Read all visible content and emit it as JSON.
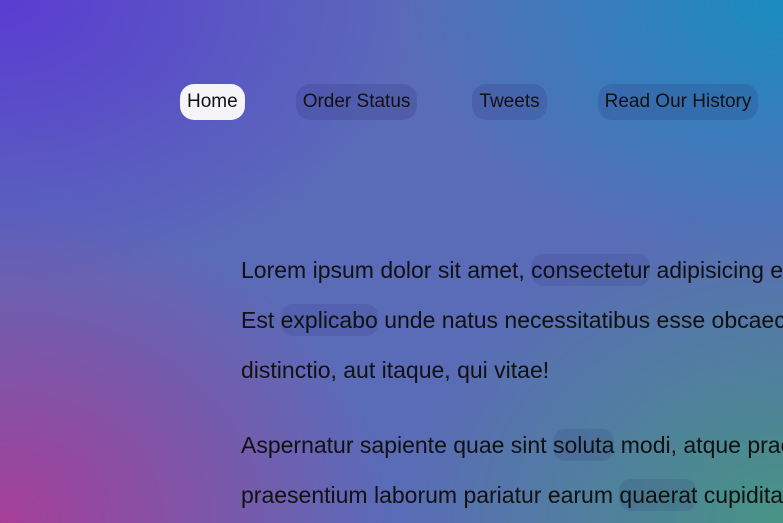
{
  "nav": {
    "items": [
      {
        "label": "Home",
        "active": true
      },
      {
        "label": "Order Status",
        "active": false
      },
      {
        "label": "Tweets",
        "active": false
      },
      {
        "label": "Read Our History",
        "active": false
      }
    ]
  },
  "content": {
    "paragraph1": {
      "line1_pre": "Lorem ipsum dolor sit amet, ",
      "line1_hl": "consectetur",
      "line1_post": " adipisicing elit.",
      "line2_pre": "Est ",
      "line2_hl": "explicabo",
      "line2_post": " unde natus necessitatibus esse obcaecati",
      "line3": "distinctio, aut itaque, qui vitae!"
    },
    "paragraph2": {
      "line1_pre": "Aspernatur sapiente quae sint ",
      "line1_hl": "soluta",
      "line1_post": " modi, atque praesentium",
      "line2_pre": "praesentium laborum pariatur earum ",
      "line2_hl": "quaerat",
      "line2_post": " cupiditate"
    }
  },
  "colors": {
    "active_pill": "#f5f4f6",
    "text": "#111111"
  }
}
